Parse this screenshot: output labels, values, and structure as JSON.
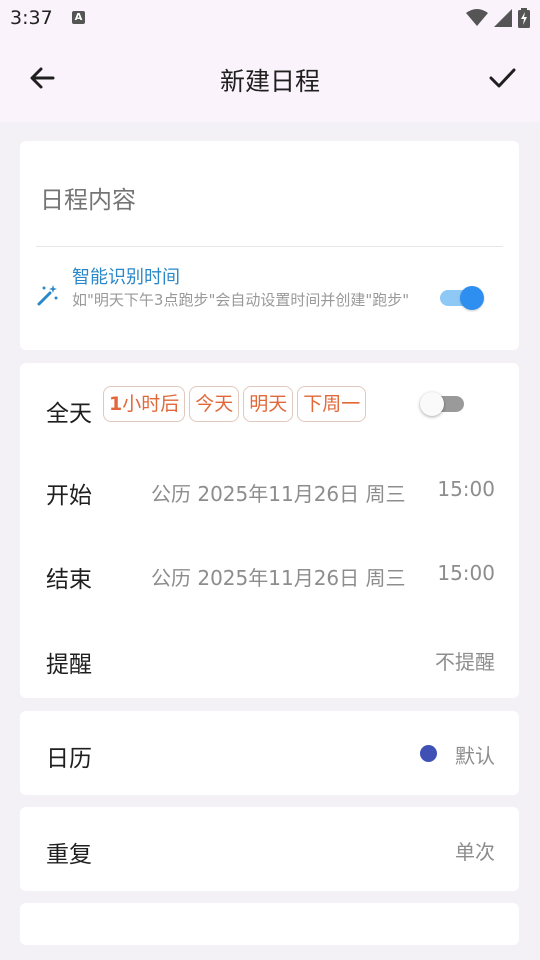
{
  "status": {
    "time": "3:37",
    "notification_glyph": "A"
  },
  "header": {
    "title": "新建日程",
    "back_icon": "arrow-back-icon",
    "confirm_icon": "check-icon"
  },
  "content_card": {
    "placeholder": "日程内容",
    "smart_title": "智能识别时间",
    "smart_desc": "如\"明天下午3点跑步\"会自动设置时间并创建\"跑步\"",
    "smart_enabled": true,
    "smart_icon": "magic-wand-icon"
  },
  "time_card": {
    "allday_label": "全天",
    "chips": [
      {
        "bold": "1",
        "rest": "小时后"
      },
      {
        "bold": "",
        "rest": "今天"
      },
      {
        "bold": "",
        "rest": "明天"
      },
      {
        "bold": "",
        "rest": "下周一"
      }
    ],
    "allday_enabled": false,
    "start_label": "开始",
    "start_date": "公历 2025年11月26日 周三",
    "start_time": "15:00",
    "end_label": "结束",
    "end_date": "公历 2025年11月26日 周三",
    "end_time": "15:00",
    "reminder_label": "提醒",
    "reminder_value": "不提醒"
  },
  "calendar_card": {
    "label": "日历",
    "value": "默认",
    "dot_color": "#3f51b5"
  },
  "repeat_card": {
    "label": "重复",
    "value": "单次"
  },
  "colors": {
    "accent": "#2f8ff0",
    "chip_text": "#e0683a",
    "smart_title": "#2a88c8"
  }
}
